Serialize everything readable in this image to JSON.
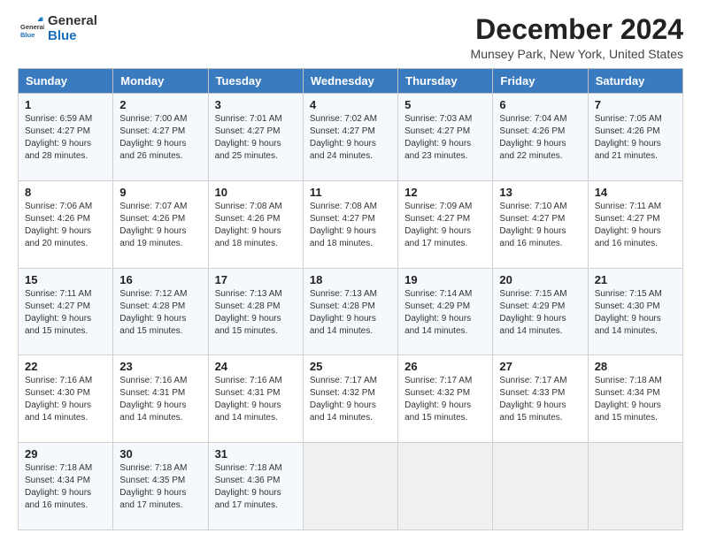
{
  "header": {
    "logo_general": "General",
    "logo_blue": "Blue",
    "title": "December 2024",
    "subtitle": "Munsey Park, New York, United States"
  },
  "columns": [
    "Sunday",
    "Monday",
    "Tuesday",
    "Wednesday",
    "Thursday",
    "Friday",
    "Saturday"
  ],
  "weeks": [
    [
      {
        "day": "1",
        "sunrise": "6:59 AM",
        "sunset": "4:27 PM",
        "daylight": "9 hours and 28 minutes."
      },
      {
        "day": "2",
        "sunrise": "7:00 AM",
        "sunset": "4:27 PM",
        "daylight": "9 hours and 26 minutes."
      },
      {
        "day": "3",
        "sunrise": "7:01 AM",
        "sunset": "4:27 PM",
        "daylight": "9 hours and 25 minutes."
      },
      {
        "day": "4",
        "sunrise": "7:02 AM",
        "sunset": "4:27 PM",
        "daylight": "9 hours and 24 minutes."
      },
      {
        "day": "5",
        "sunrise": "7:03 AM",
        "sunset": "4:27 PM",
        "daylight": "9 hours and 23 minutes."
      },
      {
        "day": "6",
        "sunrise": "7:04 AM",
        "sunset": "4:26 PM",
        "daylight": "9 hours and 22 minutes."
      },
      {
        "day": "7",
        "sunrise": "7:05 AM",
        "sunset": "4:26 PM",
        "daylight": "9 hours and 21 minutes."
      }
    ],
    [
      {
        "day": "8",
        "sunrise": "7:06 AM",
        "sunset": "4:26 PM",
        "daylight": "9 hours and 20 minutes."
      },
      {
        "day": "9",
        "sunrise": "7:07 AM",
        "sunset": "4:26 PM",
        "daylight": "9 hours and 19 minutes."
      },
      {
        "day": "10",
        "sunrise": "7:08 AM",
        "sunset": "4:26 PM",
        "daylight": "9 hours and 18 minutes."
      },
      {
        "day": "11",
        "sunrise": "7:08 AM",
        "sunset": "4:27 PM",
        "daylight": "9 hours and 18 minutes."
      },
      {
        "day": "12",
        "sunrise": "7:09 AM",
        "sunset": "4:27 PM",
        "daylight": "9 hours and 17 minutes."
      },
      {
        "day": "13",
        "sunrise": "7:10 AM",
        "sunset": "4:27 PM",
        "daylight": "9 hours and 16 minutes."
      },
      {
        "day": "14",
        "sunrise": "7:11 AM",
        "sunset": "4:27 PM",
        "daylight": "9 hours and 16 minutes."
      }
    ],
    [
      {
        "day": "15",
        "sunrise": "7:11 AM",
        "sunset": "4:27 PM",
        "daylight": "9 hours and 15 minutes."
      },
      {
        "day": "16",
        "sunrise": "7:12 AM",
        "sunset": "4:28 PM",
        "daylight": "9 hours and 15 minutes."
      },
      {
        "day": "17",
        "sunrise": "7:13 AM",
        "sunset": "4:28 PM",
        "daylight": "9 hours and 15 minutes."
      },
      {
        "day": "18",
        "sunrise": "7:13 AM",
        "sunset": "4:28 PM",
        "daylight": "9 hours and 14 minutes."
      },
      {
        "day": "19",
        "sunrise": "7:14 AM",
        "sunset": "4:29 PM",
        "daylight": "9 hours and 14 minutes."
      },
      {
        "day": "20",
        "sunrise": "7:15 AM",
        "sunset": "4:29 PM",
        "daylight": "9 hours and 14 minutes."
      },
      {
        "day": "21",
        "sunrise": "7:15 AM",
        "sunset": "4:30 PM",
        "daylight": "9 hours and 14 minutes."
      }
    ],
    [
      {
        "day": "22",
        "sunrise": "7:16 AM",
        "sunset": "4:30 PM",
        "daylight": "9 hours and 14 minutes."
      },
      {
        "day": "23",
        "sunrise": "7:16 AM",
        "sunset": "4:31 PM",
        "daylight": "9 hours and 14 minutes."
      },
      {
        "day": "24",
        "sunrise": "7:16 AM",
        "sunset": "4:31 PM",
        "daylight": "9 hours and 14 minutes."
      },
      {
        "day": "25",
        "sunrise": "7:17 AM",
        "sunset": "4:32 PM",
        "daylight": "9 hours and 14 minutes."
      },
      {
        "day": "26",
        "sunrise": "7:17 AM",
        "sunset": "4:32 PM",
        "daylight": "9 hours and 15 minutes."
      },
      {
        "day": "27",
        "sunrise": "7:17 AM",
        "sunset": "4:33 PM",
        "daylight": "9 hours and 15 minutes."
      },
      {
        "day": "28",
        "sunrise": "7:18 AM",
        "sunset": "4:34 PM",
        "daylight": "9 hours and 15 minutes."
      }
    ],
    [
      {
        "day": "29",
        "sunrise": "7:18 AM",
        "sunset": "4:34 PM",
        "daylight": "9 hours and 16 minutes."
      },
      {
        "day": "30",
        "sunrise": "7:18 AM",
        "sunset": "4:35 PM",
        "daylight": "9 hours and 17 minutes."
      },
      {
        "day": "31",
        "sunrise": "7:18 AM",
        "sunset": "4:36 PM",
        "daylight": "9 hours and 17 minutes."
      },
      null,
      null,
      null,
      null
    ]
  ]
}
